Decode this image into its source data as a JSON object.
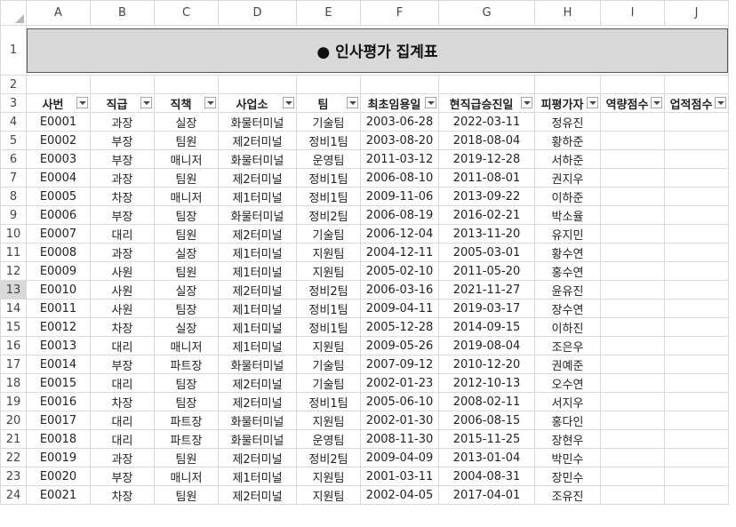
{
  "columns": [
    "A",
    "B",
    "C",
    "D",
    "E",
    "F",
    "G",
    "H",
    "I",
    "J"
  ],
  "title": "● 인사평가 집계표",
  "headers": [
    "사번",
    "직급",
    "직책",
    "사업소",
    "팀",
    "최초임용일",
    "현직급승진일",
    "피평가자",
    "역량점수",
    "업적점수"
  ],
  "row_numbers": [
    "1",
    "2",
    "3",
    "4",
    "5",
    "6",
    "7",
    "8",
    "9",
    "10",
    "11",
    "12",
    "13",
    "14",
    "15",
    "16",
    "17",
    "18",
    "19",
    "20",
    "21",
    "22",
    "23",
    "24"
  ],
  "selected_row": "13",
  "rows": [
    [
      "E0001",
      "과장",
      "실장",
      "화물터미널",
      "기술팀",
      "2003-06-28",
      "2022-03-11",
      "정유진",
      "",
      ""
    ],
    [
      "E0002",
      "부장",
      "팀원",
      "제2터미널",
      "정비1팀",
      "2003-08-20",
      "2018-08-04",
      "황하준",
      "",
      ""
    ],
    [
      "E0003",
      "부장",
      "매니저",
      "화물터미널",
      "운영팀",
      "2011-03-12",
      "2019-12-28",
      "서하준",
      "",
      ""
    ],
    [
      "E0004",
      "과장",
      "팀원",
      "제2터미널",
      "정비1팀",
      "2006-08-10",
      "2011-08-01",
      "권지우",
      "",
      ""
    ],
    [
      "E0005",
      "차장",
      "매니저",
      "제1터미널",
      "정비1팀",
      "2009-11-06",
      "2013-09-22",
      "이하준",
      "",
      ""
    ],
    [
      "E0006",
      "부장",
      "팀장",
      "화물터미널",
      "정비2팀",
      "2006-08-19",
      "2016-02-21",
      "박소율",
      "",
      ""
    ],
    [
      "E0007",
      "대리",
      "팀원",
      "제2터미널",
      "기술팀",
      "2006-12-04",
      "2013-11-20",
      "유지민",
      "",
      ""
    ],
    [
      "E0008",
      "과장",
      "실장",
      "제1터미널",
      "지원팀",
      "2004-12-11",
      "2005-03-01",
      "황수연",
      "",
      ""
    ],
    [
      "E0009",
      "사원",
      "팀원",
      "제1터미널",
      "지원팀",
      "2005-02-10",
      "2011-05-20",
      "홍수연",
      "",
      ""
    ],
    [
      "E0010",
      "사원",
      "실장",
      "제2터미널",
      "정비2팀",
      "2006-03-16",
      "2021-11-27",
      "윤유진",
      "",
      ""
    ],
    [
      "E0011",
      "사원",
      "팀장",
      "제1터미널",
      "정비1팀",
      "2009-04-11",
      "2019-03-17",
      "장수연",
      "",
      ""
    ],
    [
      "E0012",
      "차장",
      "실장",
      "제1터미널",
      "정비1팀",
      "2005-12-28",
      "2014-09-15",
      "이하진",
      "",
      ""
    ],
    [
      "E0013",
      "대리",
      "매니저",
      "제1터미널",
      "지원팀",
      "2009-05-26",
      "2019-08-04",
      "조은우",
      "",
      ""
    ],
    [
      "E0014",
      "부장",
      "파트장",
      "화물터미널",
      "기술팀",
      "2007-09-12",
      "2010-12-20",
      "권예준",
      "",
      ""
    ],
    [
      "E0015",
      "대리",
      "팀장",
      "제2터미널",
      "기술팀",
      "2002-01-23",
      "2012-10-13",
      "오수연",
      "",
      ""
    ],
    [
      "E0016",
      "차장",
      "팀장",
      "제2터미널",
      "정비1팀",
      "2005-06-10",
      "2008-02-11",
      "서지우",
      "",
      ""
    ],
    [
      "E0017",
      "대리",
      "파트장",
      "화물터미널",
      "지원팀",
      "2002-01-30",
      "2006-08-15",
      "홍다인",
      "",
      ""
    ],
    [
      "E0018",
      "대리",
      "파트장",
      "화물터미널",
      "운영팀",
      "2008-11-30",
      "2015-11-25",
      "장현우",
      "",
      ""
    ],
    [
      "E0019",
      "과장",
      "팀원",
      "제2터미널",
      "정비2팀",
      "2009-04-09",
      "2013-01-04",
      "박민수",
      "",
      ""
    ],
    [
      "E0020",
      "부장",
      "매니저",
      "제1터미널",
      "지원팀",
      "2001-03-11",
      "2004-08-31",
      "장민수",
      "",
      ""
    ],
    [
      "E0021",
      "차장",
      "팀원",
      "제2터미널",
      "지원팀",
      "2002-04-05",
      "2017-04-01",
      "조유진",
      "",
      ""
    ]
  ]
}
